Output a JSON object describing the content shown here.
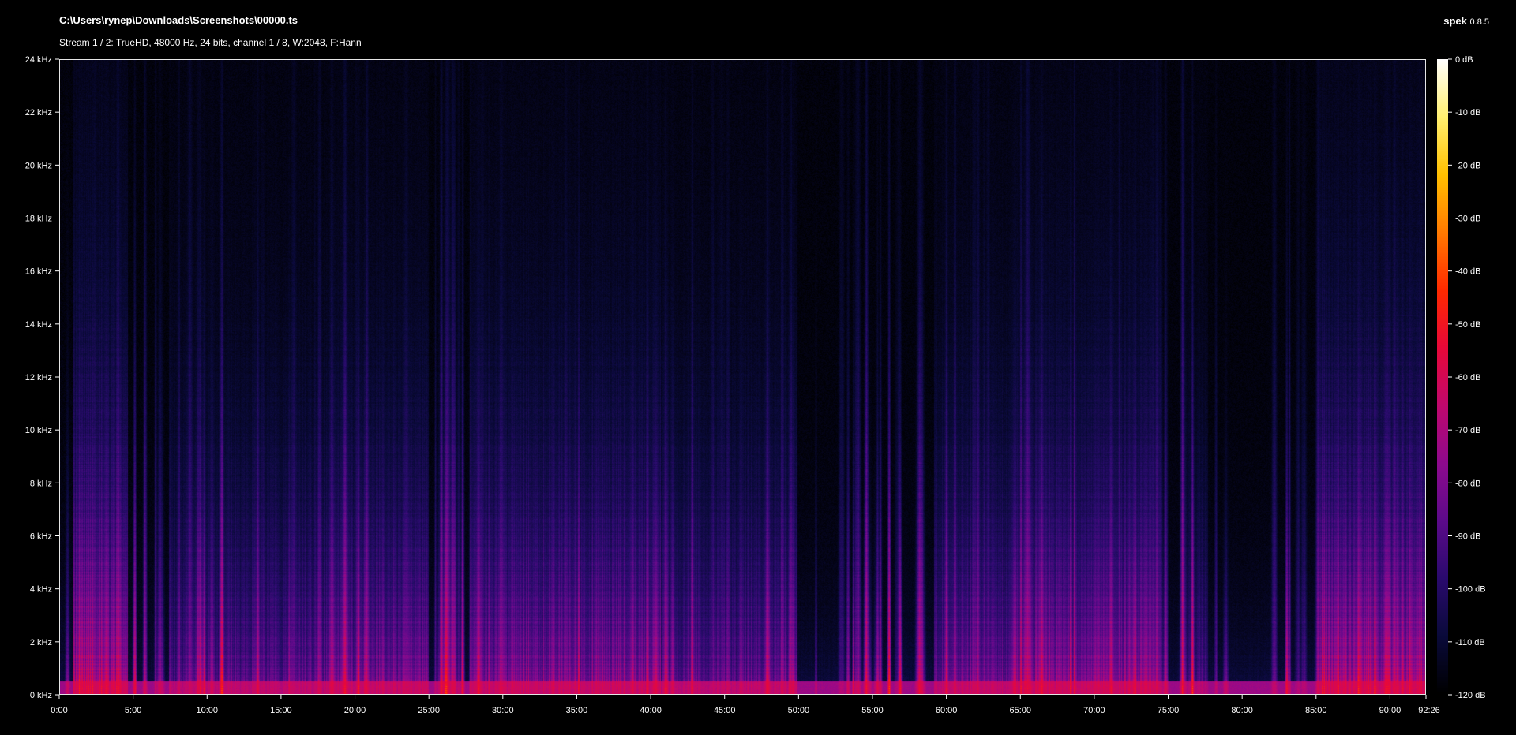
{
  "header": {
    "title": "C:\\Users\\rynep\\Downloads\\Screenshots\\00000.ts",
    "stream_info": "Stream 1 / 2: TrueHD, 48000 Hz, 24 bits, channel 1 / 8, W:2048, F:Hann",
    "app_name": "spek",
    "app_version": "0.8.5"
  },
  "chart_data": {
    "type": "heatmap",
    "x": {
      "min_seconds": 0,
      "max_seconds": 5546,
      "ticks": [
        "0:00",
        "5:00",
        "10:00",
        "15:00",
        "20:00",
        "25:00",
        "30:00",
        "35:00",
        "40:00",
        "45:00",
        "50:00",
        "55:00",
        "60:00",
        "65:00",
        "70:00",
        "75:00",
        "80:00",
        "85:00",
        "90:00"
      ],
      "end_label": "92:26"
    },
    "y": {
      "min_khz": 0,
      "max_khz": 24,
      "ticks": [
        "0 kHz",
        "2 kHz",
        "4 kHz",
        "6 kHz",
        "8 kHz",
        "10 kHz",
        "12 kHz",
        "14 kHz",
        "16 kHz",
        "18 kHz",
        "20 kHz",
        "22 kHz",
        "24 kHz"
      ]
    },
    "colorbar": {
      "min_db": -120,
      "max_db": 0,
      "ticks": [
        "0 dB",
        "-10 dB",
        "-20 dB",
        "-30 dB",
        "-40 dB",
        "-50 dB",
        "-60 dB",
        "-70 dB",
        "-80 dB",
        "-90 dB",
        "-100 dB",
        "-110 dB",
        "-120 dB"
      ],
      "colors": [
        "#000000",
        "#0a0a3a",
        "#2a0b6e",
        "#5c0a8a",
        "#8e0a8e",
        "#c0086e",
        "#e8083a",
        "#ff2a00",
        "#ff7a00",
        "#ffc000",
        "#fff070",
        "#ffffff"
      ]
    }
  }
}
